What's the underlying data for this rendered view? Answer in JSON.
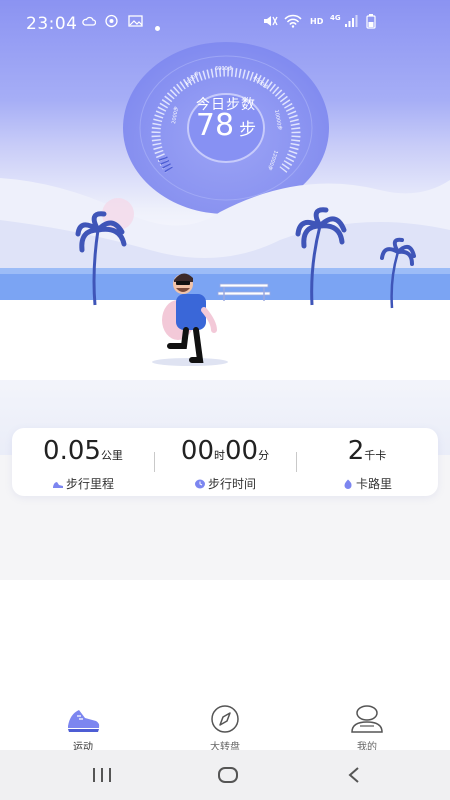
{
  "status_bar": {
    "time": "23:04",
    "left_icons": [
      "cloud-icon",
      "eye-icon",
      "image-icon",
      "dot-icon"
    ],
    "right_icons": [
      "mute-icon",
      "wifi-icon",
      "signal-icon",
      "battery-icon"
    ],
    "hd_label": "HD",
    "network_label": "4G"
  },
  "gauge": {
    "label": "今日步数",
    "value": "78",
    "unit": "步",
    "scale_marks": [
      "2000步",
      "4000步",
      "6000步",
      "8000步",
      "10000步",
      "12000步"
    ]
  },
  "stats": {
    "distance": {
      "value": "0.05",
      "unit": "公里",
      "label": "步行里程",
      "icon": "shoe-icon"
    },
    "time": {
      "hours": "00",
      "hours_unit": "时",
      "minutes": "00",
      "minutes_unit": "分",
      "label": "步行时间",
      "icon": "clock-icon"
    },
    "calories": {
      "value": "2",
      "unit": "千卡",
      "label": "卡路里",
      "icon": "flame-icon"
    }
  },
  "tabbar": {
    "tabs": [
      {
        "label": "运动",
        "icon": "sneaker-icon",
        "active": true
      },
      {
        "label": "大转盘",
        "icon": "compass-icon",
        "active": false
      },
      {
        "label": "我的",
        "icon": "profile-icon",
        "active": false
      }
    ]
  },
  "navbar": {
    "buttons": [
      "recents-button",
      "home-button",
      "back-button"
    ]
  },
  "colors": {
    "primary": "#7c86f0",
    "hero_top": "#8b93f2",
    "sea": "#7ba4f3",
    "palm": "#3f55b8"
  }
}
